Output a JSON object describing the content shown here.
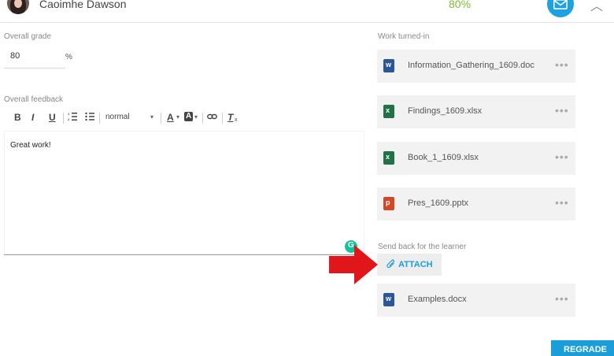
{
  "header": {
    "learner_name": "Caoimhe Dawson",
    "grade_percent": "80%",
    "grade_color": "#7dbb33",
    "mail_button_color": "#1ea1e0",
    "collapse_icon": "chevron-up-icon"
  },
  "grading": {
    "overall_grade_label": "Overall grade",
    "grade_value": "80",
    "grade_unit": "%"
  },
  "feedback": {
    "label": "Overall feedback",
    "toolbar": {
      "bold": "B",
      "italic": "I",
      "underline": "U",
      "format_select": "normal",
      "format_caret": "▾",
      "font_color": "A",
      "bg_color": "A",
      "clear_format": "T"
    },
    "text": "Great work!"
  },
  "work": {
    "label": "Work turned-in",
    "files": [
      {
        "name": "Information_Gathering_1609.doc",
        "type": "word",
        "menu": "•••"
      },
      {
        "name": "Findings_1609.xlsx",
        "type": "excel",
        "menu": "•••"
      },
      {
        "name": "Book_1_1609.xlsx",
        "type": "excel",
        "menu": "•••"
      },
      {
        "name": "Pres_1609.pptx",
        "type": "powerpoint",
        "menu": "•••"
      }
    ]
  },
  "send_back": {
    "label": "Send back for the learner",
    "attach_label": "ATTACH",
    "files": [
      {
        "name": "Examples.docx",
        "type": "word",
        "menu": "•••"
      }
    ]
  },
  "footer": {
    "regrade_label": "REGRADE"
  },
  "annotation": {
    "arrow_color": "#e0161b"
  }
}
